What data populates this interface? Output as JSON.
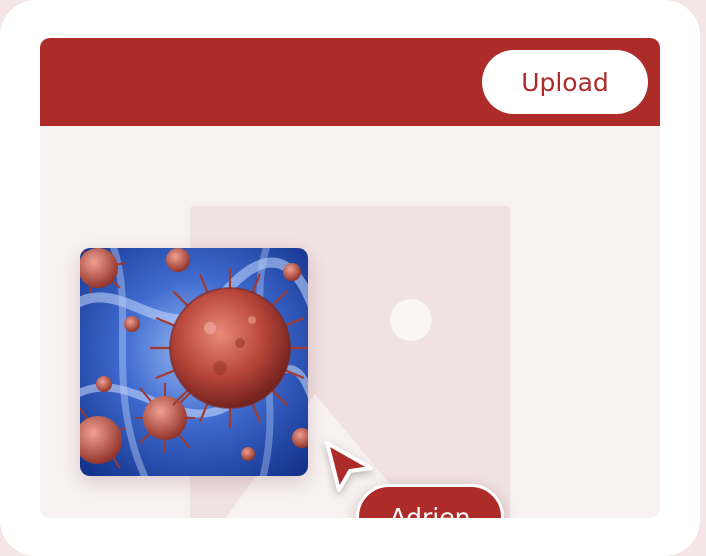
{
  "header": {
    "upload_label": "Upload",
    "color": "#ad2b28"
  },
  "canvas": {
    "placeholder_icon": "image-placeholder-icon",
    "thumbnail_icon": "virus-thumbnail-image"
  },
  "collaborator": {
    "name": "Adrien",
    "cursor_icon": "pointer-cursor-icon"
  }
}
